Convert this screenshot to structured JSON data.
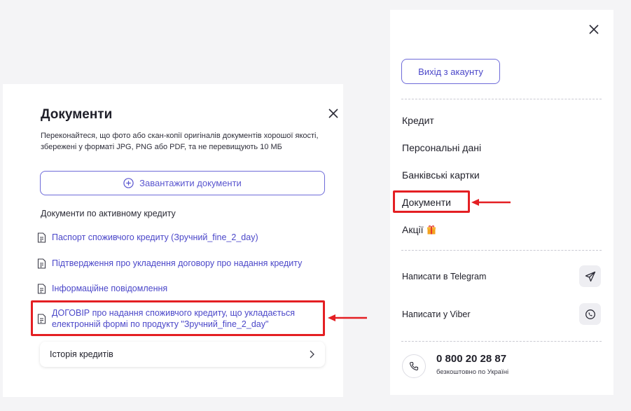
{
  "documents_panel": {
    "title": "Документи",
    "description": "Переконайтеся, що фото або скан-копії оригіналів документів хорошої якості, збережені у форматі JPG, PNG або PDF, та не перевищують 10 МБ",
    "upload_button": "Завантажити документи",
    "section_label": "Документи по активному кредиту",
    "links": [
      "Паспорт споживчого кредиту (Зручний_fine_2_day)",
      "Підтвердження про укладення договору про надання кредиту",
      "Інформаційне повідомлення",
      "ДОГОВІР про надання споживчого кредиту, що укладається електронній формі по продукту \"Зручний_fine_2_day\""
    ],
    "history_label": "Історія кредитів"
  },
  "menu_panel": {
    "logout_button": "Вихід з акаунту",
    "items": [
      "Кредит",
      "Персональні дані",
      "Банківські картки",
      "Документи",
      "Акції"
    ],
    "telegram_label": "Написати в Telegram",
    "viber_label": "Написати у Viber",
    "phone_number": "0 800 20 28 87",
    "phone_note": "безкоштовно по Україні"
  },
  "colors": {
    "accent": "#5a56cf",
    "highlight": "#e41f23",
    "background": "#f4f4f6"
  },
  "icons": {
    "close": "close-icon",
    "upload": "plus-circle-icon",
    "document": "document-icon",
    "chevron": "chevron-right-icon",
    "gift": "gift-icon",
    "telegram": "send-icon",
    "viber": "viber-icon",
    "phone": "phone-icon"
  }
}
